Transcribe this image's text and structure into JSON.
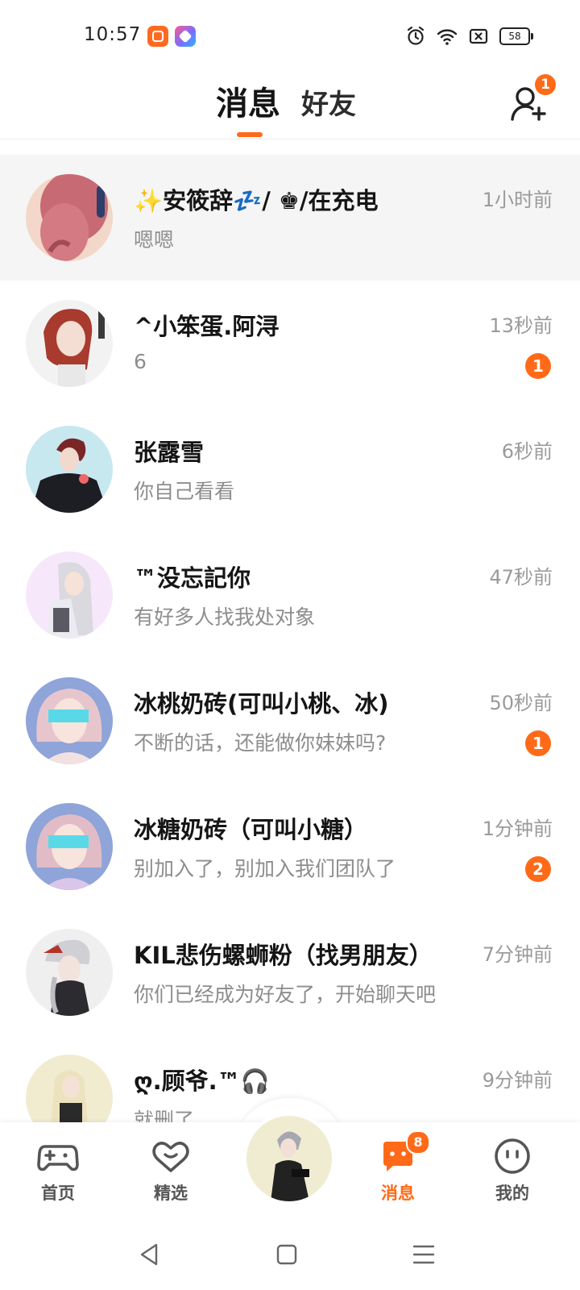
{
  "status_bar": {
    "time": "10:57",
    "battery": "58",
    "icons": [
      "app-icon-orange",
      "app-icon-gradient",
      "alarm-icon",
      "wifi-icon",
      "sim-off-icon",
      "battery-icon"
    ]
  },
  "header": {
    "tabs": [
      {
        "label": "消息",
        "active": true
      },
      {
        "label": "好友",
        "active": false
      }
    ],
    "add_friend_badge": "1",
    "accent_color": "#ff6a18"
  },
  "chats": [
    {
      "name": "✨安筱辞💤/ ♚/在充电",
      "preview": "嗯嗯",
      "time": "1小时前",
      "unread": "",
      "pinned": true
    },
    {
      "name": "^小笨蛋.阿浔",
      "preview": "6",
      "time": "13秒前",
      "unread": "1"
    },
    {
      "name": "张露雪",
      "preview": "你自己看看",
      "time": "6秒前",
      "unread": ""
    },
    {
      "name": "™没忘記你",
      "preview": "有好多人找我处对象",
      "time": "47秒前",
      "unread": ""
    },
    {
      "name": "冰桃奶砖(可叫小桃、冰)",
      "preview": "不断的话，还能做你妹妹吗?",
      "time": "50秒前",
      "unread": "1"
    },
    {
      "name": "冰糖奶砖（可叫小糖）",
      "preview": "别加入了，别加入我们团队了",
      "time": "1分钟前",
      "unread": "2"
    },
    {
      "name": "KIL悲伤螺蛳粉（找男朋友）",
      "preview": "你们已经成为好友了，开始聊天吧",
      "time": "7分钟前",
      "unread": ""
    },
    {
      "name": "ღ.顾爷.™🎧",
      "preview": "就删了",
      "time": "9分钟前",
      "unread": ""
    }
  ],
  "bottom_nav": {
    "items": [
      {
        "label": "首页",
        "icon": "gamepad-icon"
      },
      {
        "label": "精选",
        "icon": "heart-icon"
      },
      {
        "label": "消息",
        "icon": "message-icon",
        "badge": "8",
        "active": true
      },
      {
        "label": "我的",
        "icon": "smiley-icon"
      }
    ]
  },
  "system_nav": {
    "icons": [
      "back-icon",
      "home-icon",
      "menu-icon"
    ]
  }
}
